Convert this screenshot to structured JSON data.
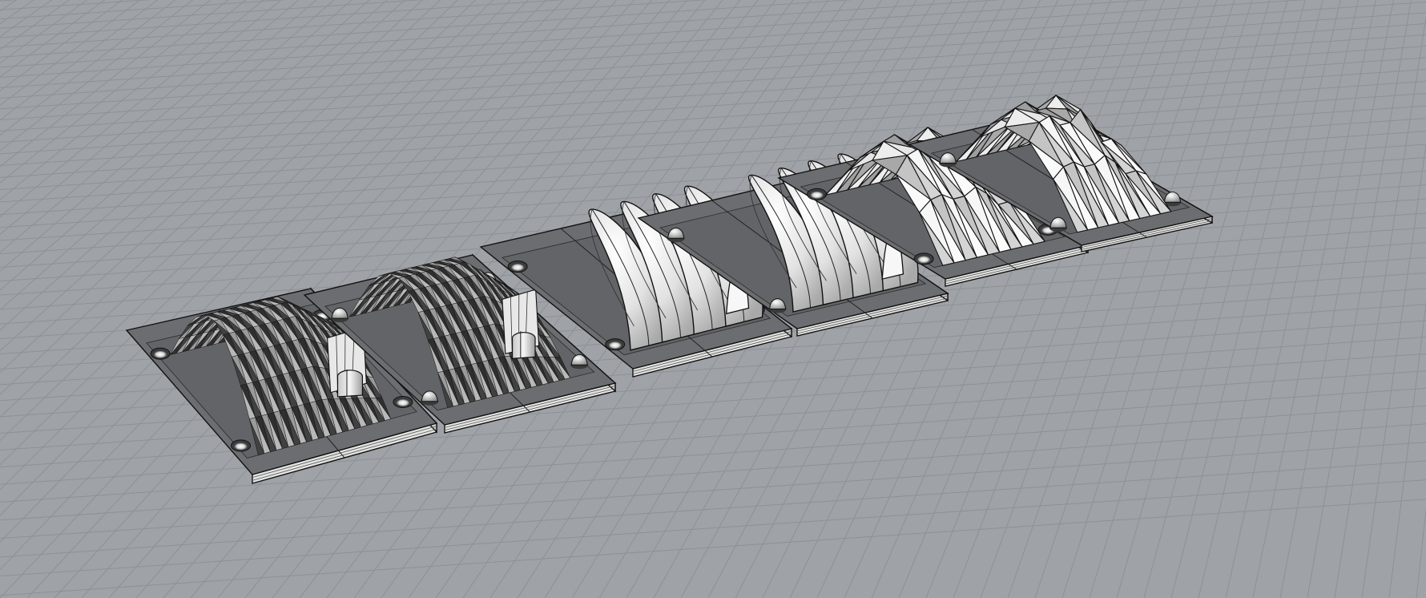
{
  "viewport": {
    "projection": "perspective",
    "background_color": "#9fa3a8",
    "grid_visible": true,
    "grid_line_color": "#8d9196"
  },
  "materials": {
    "plate_top": "#6b6d70",
    "plate_side": "#e4e4e2",
    "plate_edge": "#111111",
    "surface_light": "#f1f1f1",
    "surface_shade": "#b9b9b9",
    "surface_dark": "#6f6f6f",
    "facet_line": "#141414"
  },
  "objects": [
    {
      "name": "fine-faceted-mold-left",
      "shape": "finely faceted dome row",
      "tessellation": "fine"
    },
    {
      "name": "fine-faceted-mold-right",
      "shape": "finely faceted dome row",
      "tessellation": "fine"
    },
    {
      "name": "smooth-dome-mold-left",
      "shape": "smooth dome row",
      "tessellation": "smooth"
    },
    {
      "name": "smooth-dome-mold-right",
      "shape": "smooth dome row",
      "tessellation": "smooth"
    },
    {
      "name": "coarse-faceted-mold-left",
      "shape": "coarsely faceted dome row",
      "tessellation": "coarse"
    },
    {
      "name": "coarse-faceted-mold-right",
      "shape": "coarsely faceted dome row",
      "tessellation": "coarse"
    }
  ]
}
